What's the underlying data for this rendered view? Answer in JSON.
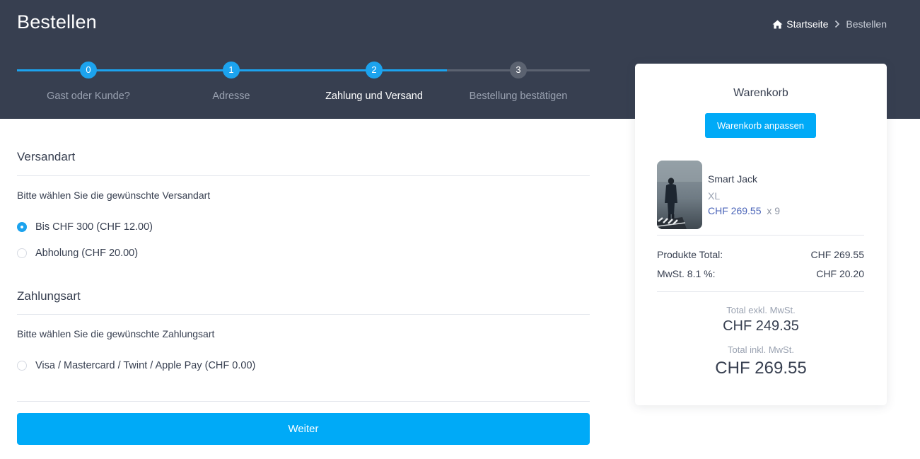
{
  "page": {
    "title": "Bestellen"
  },
  "breadcrumb": {
    "home_label": "Startseite",
    "current_label": "Bestellen"
  },
  "steps": [
    {
      "number": "0",
      "label": "Gast oder Kunde?",
      "state": "done"
    },
    {
      "number": "1",
      "label": "Adresse",
      "state": "done"
    },
    {
      "number": "2",
      "label": "Zahlung und Versand",
      "state": "active"
    },
    {
      "number": "3",
      "label": "Bestellung bestätigen",
      "state": "todo"
    }
  ],
  "shipping": {
    "title": "Versandart",
    "hint": "Bitte wählen Sie die gewünschte Versandart",
    "options": [
      {
        "label": "Bis CHF 300 (CHF 12.00)",
        "selected": true
      },
      {
        "label": "Abholung (CHF 20.00)",
        "selected": false
      }
    ]
  },
  "payment": {
    "title": "Zahlungsart",
    "hint": "Bitte wählen Sie die gewünschte Zahlungsart",
    "options": [
      {
        "label": "Visa / Mastercard / Twint / Apple Pay (CHF 0.00)",
        "selected": false
      }
    ]
  },
  "next_button": "Weiter",
  "cart": {
    "title": "Warenkorb",
    "edit_button": "Warenkorb anpassen",
    "item": {
      "name": "Smart Jack",
      "size": "XL",
      "price": "CHF 269.55",
      "quantity": "x 9"
    },
    "products_total_label": "Produkte Total:",
    "products_total_value": "CHF 269.55",
    "vat_label": "MwSt. 8.1 %:",
    "vat_value": "CHF 20.20",
    "total_excl_label": "Total exkl. MwSt.",
    "total_excl_value": "CHF 249.35",
    "total_incl_label": "Total inkl. MwSt.",
    "total_incl_value": "CHF 269.55"
  },
  "colors": {
    "header_bg": "#373f50",
    "accent": "#00aaf7",
    "progress": "#1ca3ee",
    "step_inactive": "#5b6270"
  },
  "icons": {
    "home": "home-icon",
    "separator": "chevron-right-icon"
  }
}
